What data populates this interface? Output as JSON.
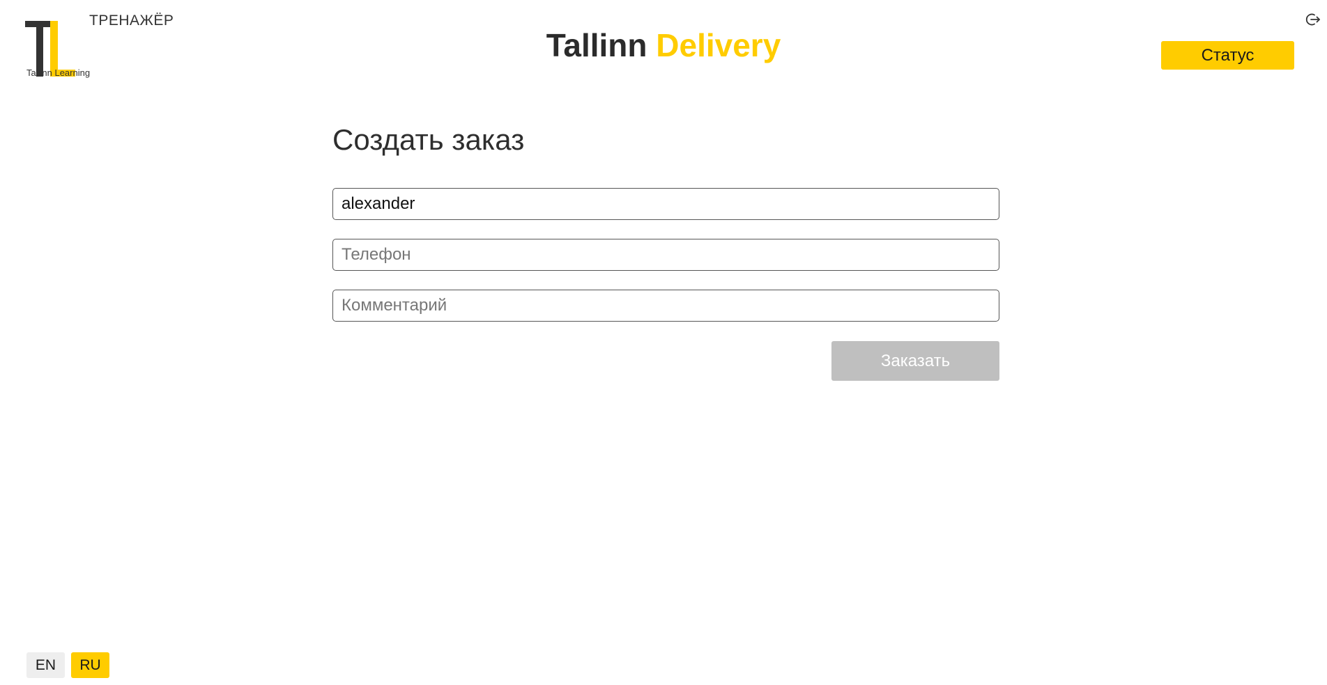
{
  "logo": {
    "trainer_label": "ТРЕНАЖЁР",
    "company_name": "Tallinn Learning",
    "mark_letters": "TL"
  },
  "header": {
    "title_part1": "Tallinn",
    "title_part2": "Delivery",
    "status_label": "Статус",
    "logout_icon": "logout-icon"
  },
  "form": {
    "title": "Создать заказ",
    "name_value": "alexander",
    "phone_placeholder": "Телефон",
    "phone_value": "",
    "comment_placeholder": "Комментарий",
    "comment_value": "",
    "submit_label": "Заказать"
  },
  "language": {
    "en_label": "EN",
    "ru_label": "RU",
    "active": "RU"
  },
  "colors": {
    "accent": "#ffcc00",
    "text_dark": "#2b2b2b",
    "disabled_button": "#bfbfbf"
  }
}
